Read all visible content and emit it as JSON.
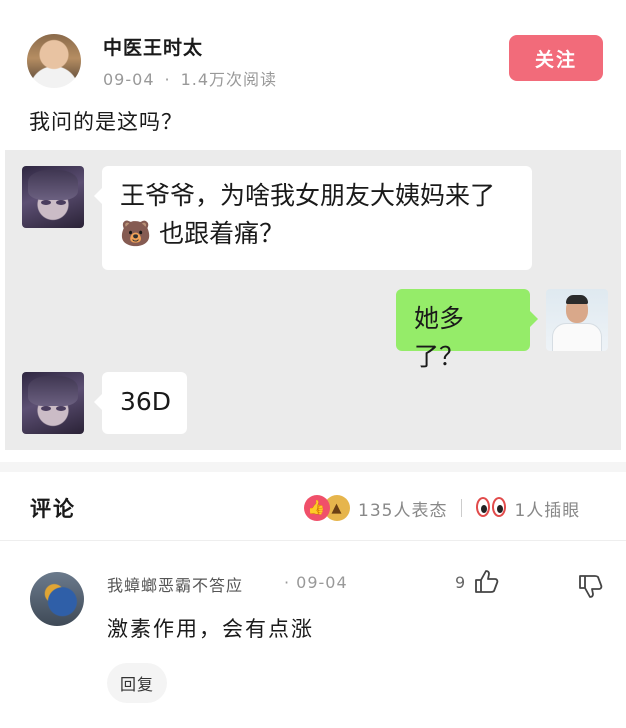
{
  "post": {
    "author_name": "中医王时太",
    "date": "09-04",
    "views": "1.4万次阅读",
    "follow_label": "关注",
    "text": "我问的是这吗？"
  },
  "chat": {
    "messages": [
      {
        "side": "left",
        "text_line1": "王爷爷，为啥我女朋友大姨妈来了",
        "text_line2": "🐻 也跟着痛？"
      },
      {
        "side": "right",
        "text": "她多了？"
      },
      {
        "side": "left",
        "text": "36D"
      }
    ]
  },
  "comments": {
    "title": "评论",
    "reactions_count": "135人表态",
    "eyes_count": "1人插眼",
    "items": [
      {
        "user": "我蟑螂恶霸不答应",
        "date": "· 09-04",
        "likes": "9",
        "text": "激素作用，会有点涨",
        "reply_label": "回复"
      }
    ]
  },
  "colors": {
    "follow": "#f26b7a",
    "chat_bg": "#ebebeb",
    "green_bubble": "#95ec69",
    "like_red": "#f0506a"
  }
}
